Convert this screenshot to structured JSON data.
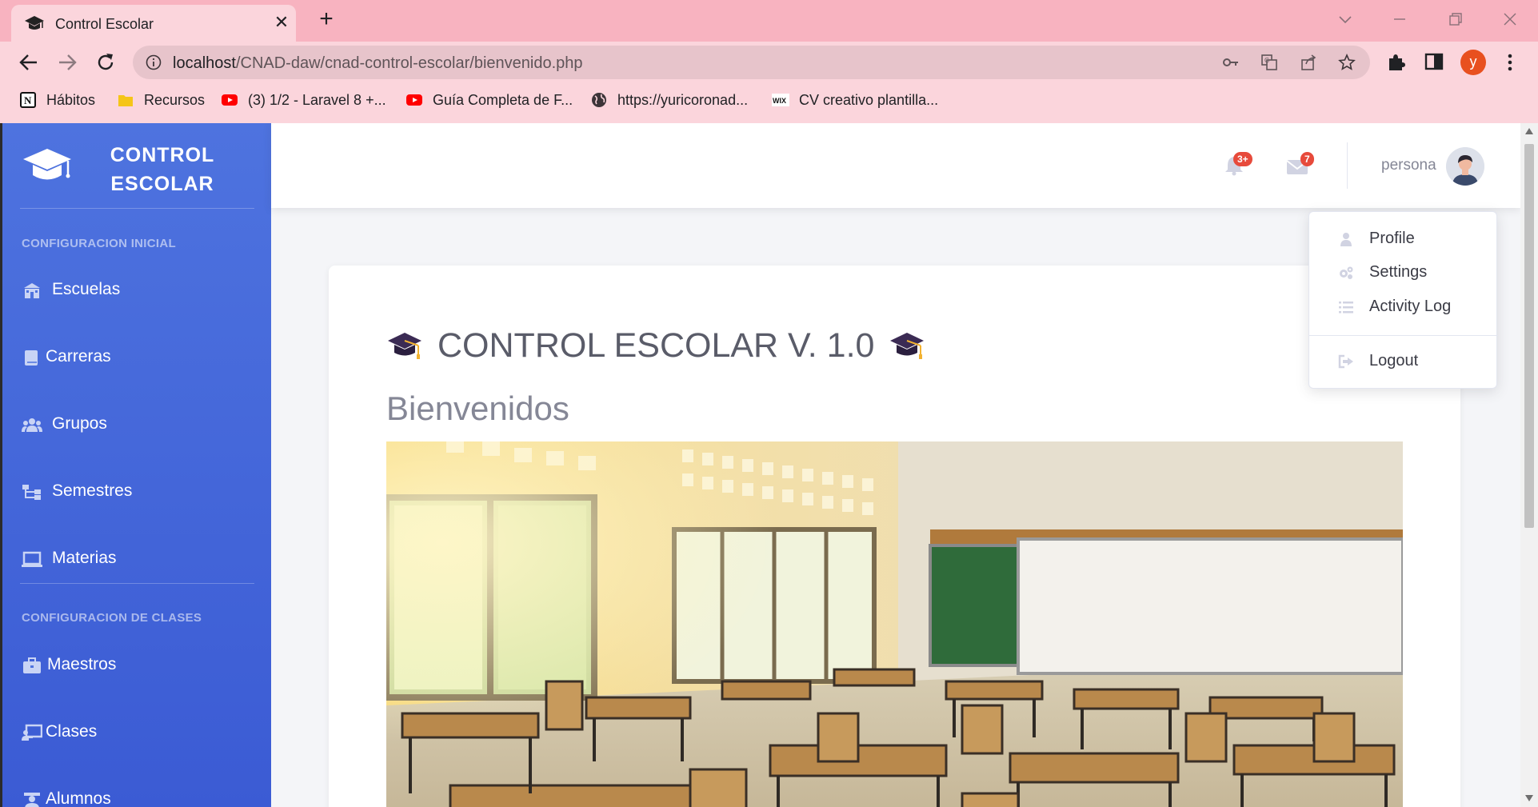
{
  "browser": {
    "tab_title": "Control Escolar",
    "url_host": "localhost",
    "url_path": "/CNAD-daw/cnad-control-escolar/bienvenido.php",
    "profile_initial": "y",
    "bookmarks": [
      {
        "label": "Hábitos",
        "icon": "notion-icon"
      },
      {
        "label": "Recursos",
        "icon": "folder-icon"
      },
      {
        "label": "(3) 1/2 - Laravel 8 +...",
        "icon": "youtube-icon"
      },
      {
        "label": "Guía Completa de F...",
        "icon": "youtube-icon"
      },
      {
        "label": "https://yuricoronad...",
        "icon": "globe-icon"
      },
      {
        "label": "CV creativo plantilla...",
        "icon": "wix-icon"
      }
    ]
  },
  "sidebar": {
    "brand_line1": "CONTROL",
    "brand_line2": "ESCOLAR",
    "heading_initial": "CONFIGURACION INICIAL",
    "heading_classes": "CONFIGURACION DE CLASES",
    "items": [
      {
        "label": "Escuelas",
        "icon": "school-icon"
      },
      {
        "label": "Carreras",
        "icon": "book-icon"
      },
      {
        "label": "Grupos",
        "icon": "users-icon"
      },
      {
        "label": "Semestres",
        "icon": "sitemap-icon"
      },
      {
        "label": "Materias",
        "icon": "laptop-icon"
      },
      {
        "label": "Maestros",
        "icon": "briefcase-icon"
      },
      {
        "label": "Clases",
        "icon": "chalkboard-icon"
      },
      {
        "label": "Alumnos",
        "icon": "student-icon"
      }
    ]
  },
  "topbar": {
    "alerts_badge": "3+",
    "messages_badge": "7",
    "username": "persona"
  },
  "user_menu": {
    "items": [
      {
        "label": "Profile",
        "icon": "user-icon"
      },
      {
        "label": "Settings",
        "icon": "cogs-icon"
      },
      {
        "label": "Activity Log",
        "icon": "list-icon"
      },
      {
        "label": "Logout",
        "icon": "sign-out-icon"
      }
    ]
  },
  "main": {
    "title": "CONTROL ESCOLAR V. 1.0",
    "subtitle": "Bienvenidos"
  },
  "colors": {
    "sidebar": "#4e73df",
    "badge": "#e74a3b",
    "tabstrip": "#f8b3c0"
  }
}
